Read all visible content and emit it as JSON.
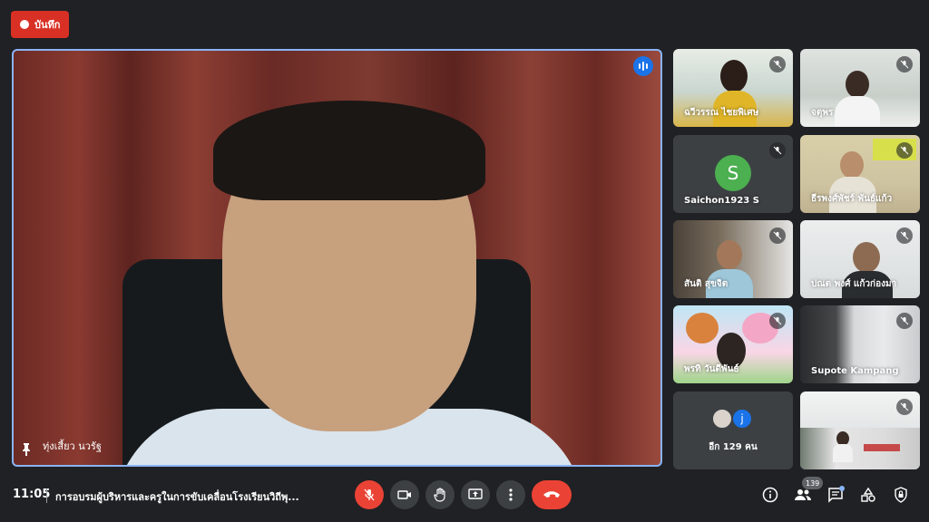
{
  "recording": {
    "label": "บันทึก",
    "color": "#d93025"
  },
  "main_speaker": {
    "name": "ทุ่งเสี้ยว นวรัฐ",
    "speaking": true,
    "pinned": true
  },
  "participants": [
    {
      "name": "ฉวีวรรณ ไชยพิเศษ",
      "muted": true
    },
    {
      "name": "จตุพร",
      "muted": true
    },
    {
      "name": "Saichon1923 S",
      "muted": true,
      "avatar_letter": "S",
      "avatar_color": "#4caf50"
    },
    {
      "name": "ธีรพงศ์พัชร์ พันธ์แก้ว",
      "muted": true
    },
    {
      "name": "สันติ สุขจิต",
      "muted": true
    },
    {
      "name": "ปณต พงศ์ แก้วก่องมา",
      "muted": true
    },
    {
      "name": "พรทิ วันดีพันธ์",
      "muted": true
    },
    {
      "name": "Supote Kampang",
      "muted": true
    },
    {
      "name": "",
      "muted": true
    }
  ],
  "others": {
    "label": "อีก 129 คน",
    "avatar_letter": "j",
    "avatar_color": "#1a73e8"
  },
  "bottom": {
    "time": "11:05",
    "meeting_title": "การอบรมผู้บริหารและครูในการขับเคลื่อนโรงเรียนวิถีพุ...",
    "people_count": "139"
  },
  "controls": [
    "mic-off",
    "camera",
    "raise-hand",
    "present",
    "more",
    "end-call"
  ],
  "right_controls": [
    "info",
    "people",
    "chat",
    "activities",
    "host-controls"
  ]
}
